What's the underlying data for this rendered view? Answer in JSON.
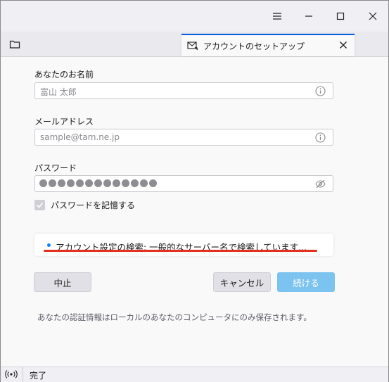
{
  "window": {
    "controls": {
      "menu_icon": "hamburger-icon",
      "minimize_icon": "minimize-icon",
      "maximize_icon": "maximize-icon",
      "close_icon": "close-icon"
    }
  },
  "tabbar": {
    "folder_icon": "folder-icon",
    "tab": {
      "title": "アカウントのセットアップ",
      "icon": "mail-setup-icon",
      "close_icon": "close-icon"
    }
  },
  "form": {
    "name": {
      "label": "あなたのお名前",
      "placeholder": "富山 太郎",
      "icon": "info-icon"
    },
    "email": {
      "label": "メールアドレス",
      "placeholder": "sample@tam.ne.jp",
      "icon": "info-icon"
    },
    "password": {
      "label": "パスワード",
      "masked_length": 13,
      "icon": "eye-slash-icon"
    },
    "remember": {
      "label": "パスワードを記憶する",
      "checked": true
    }
  },
  "status": {
    "text": "アカウント設定の検索: 一般的なサーバー名で検索しています..."
  },
  "buttons": {
    "stop": "中止",
    "cancel": "キャンセル",
    "continue": "続ける"
  },
  "footnote": "あなたの認証情報はローカルのあなたのコンピュータにのみ保存されます。",
  "statusbar": {
    "icon": "broadcast-icon",
    "text": "完了"
  },
  "colors": {
    "accent": "#0061e0",
    "continue_button": "#7cc3ef",
    "highlight_underline": "#e2311d"
  }
}
